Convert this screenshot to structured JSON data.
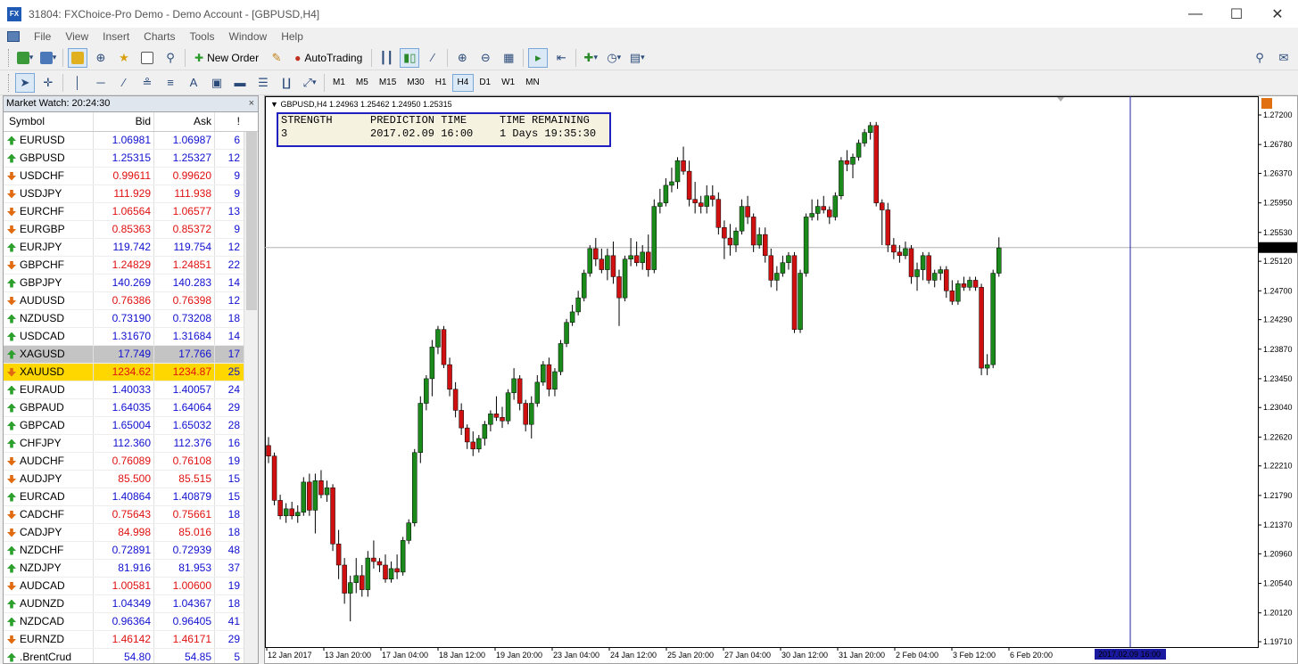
{
  "window": {
    "title": "31804: FXChoice-Pro Demo - Demo Account - [GBPUSD,H4]",
    "logo": "FX"
  },
  "menu": [
    "File",
    "View",
    "Insert",
    "Charts",
    "Tools",
    "Window",
    "Help"
  ],
  "toolbar": {
    "new_order": "New Order",
    "autotrading": "AutoTrading"
  },
  "timeframes": [
    "M1",
    "M5",
    "M15",
    "M30",
    "H1",
    "H4",
    "D1",
    "W1",
    "MN"
  ],
  "active_timeframe": "H4",
  "market_watch": {
    "title": "Market Watch: 20:24:30",
    "columns": {
      "symbol": "Symbol",
      "bid": "Bid",
      "ask": "Ask",
      "spread": "!"
    },
    "rows": [
      {
        "symbol": "EURUSD",
        "bid": "1.06981",
        "ask": "1.06987",
        "spread": "6",
        "dir": "up",
        "color": "blue"
      },
      {
        "symbol": "GBPUSD",
        "bid": "1.25315",
        "ask": "1.25327",
        "spread": "12",
        "dir": "up",
        "color": "blue"
      },
      {
        "symbol": "USDCHF",
        "bid": "0.99611",
        "ask": "0.99620",
        "spread": "9",
        "dir": "down",
        "color": "red"
      },
      {
        "symbol": "USDJPY",
        "bid": "111.929",
        "ask": "111.938",
        "spread": "9",
        "dir": "down",
        "color": "red"
      },
      {
        "symbol": "EURCHF",
        "bid": "1.06564",
        "ask": "1.06577",
        "spread": "13",
        "dir": "down",
        "color": "red"
      },
      {
        "symbol": "EURGBP",
        "bid": "0.85363",
        "ask": "0.85372",
        "spread": "9",
        "dir": "down",
        "color": "red"
      },
      {
        "symbol": "EURJPY",
        "bid": "119.742",
        "ask": "119.754",
        "spread": "12",
        "dir": "up",
        "color": "blue"
      },
      {
        "symbol": "GBPCHF",
        "bid": "1.24829",
        "ask": "1.24851",
        "spread": "22",
        "dir": "down",
        "color": "red"
      },
      {
        "symbol": "GBPJPY",
        "bid": "140.269",
        "ask": "140.283",
        "spread": "14",
        "dir": "up",
        "color": "blue"
      },
      {
        "symbol": "AUDUSD",
        "bid": "0.76386",
        "ask": "0.76398",
        "spread": "12",
        "dir": "down",
        "color": "red"
      },
      {
        "symbol": "NZDUSD",
        "bid": "0.73190",
        "ask": "0.73208",
        "spread": "18",
        "dir": "up",
        "color": "blue"
      },
      {
        "symbol": "USDCAD",
        "bid": "1.31670",
        "ask": "1.31684",
        "spread": "14",
        "dir": "up",
        "color": "blue"
      },
      {
        "symbol": "XAGUSD",
        "bid": "17.749",
        "ask": "17.766",
        "spread": "17",
        "dir": "up",
        "color": "blue",
        "state": "selected"
      },
      {
        "symbol": "XAUUSD",
        "bid": "1234.62",
        "ask": "1234.87",
        "spread": "25",
        "dir": "down",
        "color": "red",
        "state": "highlight"
      },
      {
        "symbol": "EURAUD",
        "bid": "1.40033",
        "ask": "1.40057",
        "spread": "24",
        "dir": "up",
        "color": "blue"
      },
      {
        "symbol": "GBPAUD",
        "bid": "1.64035",
        "ask": "1.64064",
        "spread": "29",
        "dir": "up",
        "color": "blue"
      },
      {
        "symbol": "GBPCAD",
        "bid": "1.65004",
        "ask": "1.65032",
        "spread": "28",
        "dir": "up",
        "color": "blue"
      },
      {
        "symbol": "CHFJPY",
        "bid": "112.360",
        "ask": "112.376",
        "spread": "16",
        "dir": "up",
        "color": "blue"
      },
      {
        "symbol": "AUDCHF",
        "bid": "0.76089",
        "ask": "0.76108",
        "spread": "19",
        "dir": "down",
        "color": "red"
      },
      {
        "symbol": "AUDJPY",
        "bid": "85.500",
        "ask": "85.515",
        "spread": "15",
        "dir": "down",
        "color": "red"
      },
      {
        "symbol": "EURCAD",
        "bid": "1.40864",
        "ask": "1.40879",
        "spread": "15",
        "dir": "up",
        "color": "blue"
      },
      {
        "symbol": "CADCHF",
        "bid": "0.75643",
        "ask": "0.75661",
        "spread": "18",
        "dir": "down",
        "color": "red"
      },
      {
        "symbol": "CADJPY",
        "bid": "84.998",
        "ask": "85.016",
        "spread": "18",
        "dir": "down",
        "color": "red"
      },
      {
        "symbol": "NZDCHF",
        "bid": "0.72891",
        "ask": "0.72939",
        "spread": "48",
        "dir": "up",
        "color": "blue"
      },
      {
        "symbol": "NZDJPY",
        "bid": "81.916",
        "ask": "81.953",
        "spread": "37",
        "dir": "up",
        "color": "blue"
      },
      {
        "symbol": "AUDCAD",
        "bid": "1.00581",
        "ask": "1.00600",
        "spread": "19",
        "dir": "down",
        "color": "red"
      },
      {
        "symbol": "AUDNZD",
        "bid": "1.04349",
        "ask": "1.04367",
        "spread": "18",
        "dir": "up",
        "color": "blue"
      },
      {
        "symbol": "NZDCAD",
        "bid": "0.96364",
        "ask": "0.96405",
        "spread": "41",
        "dir": "up",
        "color": "blue"
      },
      {
        "symbol": "EURNZD",
        "bid": "1.46142",
        "ask": "1.46171",
        "spread": "29",
        "dir": "down",
        "color": "red"
      },
      {
        "symbol": ".BrentCrud",
        "bid": "54.80",
        "ask": "54.85",
        "spread": "5",
        "dir": "up",
        "color": "blue"
      }
    ]
  },
  "chart": {
    "info": "GBPUSD,H4  1.24963 1.25462 1.24950 1.25315",
    "prediction": {
      "strength_label": "STRENGTH",
      "strength_value": "3",
      "time_label": "PREDICTION TIME",
      "time_value": "2017.02.09 16:00",
      "remaining_label": "TIME REMAINING",
      "remaining_value": "1 Days 19:35:30"
    },
    "marker_time": "2017.02.09 16:00"
  },
  "chart_data": {
    "type": "candlestick",
    "price_ticks": [
      "1.27200",
      "1.26780",
      "1.26370",
      "1.25950",
      "1.25530",
      "1.25120",
      "1.24700",
      "1.24290",
      "1.23870",
      "1.23450",
      "1.23040",
      "1.22620",
      "1.22210",
      "1.21790",
      "1.21370",
      "1.20960",
      "1.20540",
      "1.20120",
      "1.19710"
    ],
    "ylim": [
      1.1971,
      1.272
    ],
    "current_price": "1.25315",
    "time_labels": [
      "12 Jan 2017",
      "13 Jan 20:00",
      "17 Jan 04:00",
      "18 Jan 12:00",
      "19 Jan 20:00",
      "23 Jan 04:00",
      "24 Jan 12:00",
      "25 Jan 20:00",
      "27 Jan 04:00",
      "30 Jan 12:00",
      "31 Jan 20:00",
      "2 Feb 04:00",
      "3 Feb 12:00",
      "6 Feb 20:00"
    ],
    "colors": {
      "bull": "#1a8a1a",
      "bear": "#d01010",
      "wick": "#000000",
      "panel_border": "#2020c0",
      "marker": "#2020a0"
    },
    "candles": [
      [
        1.225,
        1.2262,
        1.2225,
        1.2235
      ],
      [
        1.2235,
        1.224,
        1.2165,
        1.2172
      ],
      [
        1.2172,
        1.218,
        1.2145,
        1.215
      ],
      [
        1.215,
        1.2168,
        1.214,
        1.216
      ],
      [
        1.216,
        1.217,
        1.2145,
        1.215
      ],
      [
        1.215,
        1.2165,
        1.214,
        1.2155
      ],
      [
        1.2155,
        1.2205,
        1.215,
        1.2198
      ],
      [
        1.2198,
        1.221,
        1.215,
        1.2158
      ],
      [
        1.2158,
        1.221,
        1.2125,
        1.22
      ],
      [
        1.22,
        1.2215,
        1.2175,
        1.218
      ],
      [
        1.218,
        1.22,
        1.217,
        1.219
      ],
      [
        1.219,
        1.2195,
        1.21,
        1.211
      ],
      [
        1.211,
        1.213,
        1.206,
        1.208
      ],
      [
        1.208,
        1.209,
        1.2025,
        1.204
      ],
      [
        1.204,
        1.2065,
        1.2,
        1.2055
      ],
      [
        1.2055,
        1.209,
        1.204,
        1.2065
      ],
      [
        1.2065,
        1.208,
        1.2035,
        1.2045
      ],
      [
        1.2045,
        1.21,
        1.2035,
        1.209
      ],
      [
        1.209,
        1.2115,
        1.2075,
        1.2085
      ],
      [
        1.2085,
        1.209,
        1.207,
        1.208
      ],
      [
        1.208,
        1.2095,
        1.2055,
        1.206
      ],
      [
        1.206,
        1.2085,
        1.2055,
        1.2075
      ],
      [
        1.2075,
        1.2095,
        1.206,
        1.207
      ],
      [
        1.207,
        1.212,
        1.2065,
        1.2115
      ],
      [
        1.2115,
        1.2145,
        1.211,
        1.214
      ],
      [
        1.214,
        1.2245,
        1.2135,
        1.224
      ],
      [
        1.224,
        1.232,
        1.2225,
        1.231
      ],
      [
        1.231,
        1.235,
        1.23,
        1.2345
      ],
      [
        1.2345,
        1.24,
        1.232,
        1.239
      ],
      [
        1.239,
        1.242,
        1.238,
        1.2415
      ],
      [
        1.2415,
        1.242,
        1.236,
        1.2365
      ],
      [
        1.2365,
        1.2375,
        1.232,
        1.233
      ],
      [
        1.233,
        1.234,
        1.229,
        1.23
      ],
      [
        1.23,
        1.231,
        1.2265,
        1.2275
      ],
      [
        1.2275,
        1.228,
        1.2245,
        1.2255
      ],
      [
        1.2255,
        1.227,
        1.2235,
        1.2245
      ],
      [
        1.2245,
        1.2265,
        1.224,
        1.226
      ],
      [
        1.226,
        1.2285,
        1.225,
        1.228
      ],
      [
        1.228,
        1.23,
        1.227,
        1.2295
      ],
      [
        1.2295,
        1.232,
        1.2285,
        1.229
      ],
      [
        1.229,
        1.2305,
        1.2275,
        1.2285
      ],
      [
        1.2285,
        1.233,
        1.228,
        1.2325
      ],
      [
        1.2325,
        1.236,
        1.2315,
        1.2345
      ],
      [
        1.2345,
        1.235,
        1.23,
        1.231
      ],
      [
        1.231,
        1.2315,
        1.227,
        1.228
      ],
      [
        1.228,
        1.232,
        1.226,
        1.231
      ],
      [
        1.231,
        1.235,
        1.2305,
        1.234
      ],
      [
        1.234,
        1.237,
        1.2335,
        1.2365
      ],
      [
        1.2365,
        1.2375,
        1.232,
        1.233
      ],
      [
        1.233,
        1.236,
        1.232,
        1.2355
      ],
      [
        1.2355,
        1.24,
        1.235,
        1.2395
      ],
      [
        1.2395,
        1.243,
        1.239,
        1.2425
      ],
      [
        1.2425,
        1.245,
        1.242,
        1.244
      ],
      [
        1.244,
        1.247,
        1.2435,
        1.246
      ],
      [
        1.246,
        1.25,
        1.2455,
        1.2495
      ],
      [
        1.2495,
        1.2535,
        1.249,
        1.253
      ],
      [
        1.253,
        1.2545,
        1.2505,
        1.2515
      ],
      [
        1.2515,
        1.253,
        1.2495,
        1.25
      ],
      [
        1.25,
        1.253,
        1.2485,
        1.252
      ],
      [
        1.252,
        1.254,
        1.248,
        1.249
      ],
      [
        1.249,
        1.25,
        1.242,
        1.246
      ],
      [
        1.246,
        1.252,
        1.2455,
        1.2515
      ],
      [
        1.2515,
        1.2545,
        1.2505,
        1.252
      ],
      [
        1.252,
        1.254,
        1.2505,
        1.251
      ],
      [
        1.251,
        1.2535,
        1.25,
        1.2525
      ],
      [
        1.2525,
        1.255,
        1.249,
        1.25
      ],
      [
        1.25,
        1.26,
        1.2495,
        1.259
      ],
      [
        1.259,
        1.2615,
        1.258,
        1.2595
      ],
      [
        1.2595,
        1.263,
        1.259,
        1.262
      ],
      [
        1.262,
        1.2645,
        1.261,
        1.2625
      ],
      [
        1.2625,
        1.266,
        1.2615,
        1.2655
      ],
      [
        1.2655,
        1.2675,
        1.2635,
        1.264
      ],
      [
        1.264,
        1.2655,
        1.259,
        1.26
      ],
      [
        1.26,
        1.2625,
        1.258,
        1.2595
      ],
      [
        1.2595,
        1.2605,
        1.258,
        1.259
      ],
      [
        1.259,
        1.262,
        1.258,
        1.2605
      ],
      [
        1.2605,
        1.262,
        1.259,
        1.26
      ],
      [
        1.26,
        1.261,
        1.255,
        1.256
      ],
      [
        1.256,
        1.257,
        1.2515,
        1.2545
      ],
      [
        1.2545,
        1.2565,
        1.252,
        1.2535
      ],
      [
        1.2535,
        1.256,
        1.2525,
        1.2555
      ],
      [
        1.2555,
        1.26,
        1.255,
        1.259
      ],
      [
        1.259,
        1.2605,
        1.2565,
        1.2575
      ],
      [
        1.2575,
        1.258,
        1.2525,
        1.2535
      ],
      [
        1.2535,
        1.256,
        1.253,
        1.255
      ],
      [
        1.255,
        1.256,
        1.251,
        1.252
      ],
      [
        1.252,
        1.253,
        1.2475,
        1.2485
      ],
      [
        1.2485,
        1.2505,
        1.247,
        1.2495
      ],
      [
        1.2495,
        1.252,
        1.249,
        1.251
      ],
      [
        1.251,
        1.2525,
        1.25,
        1.252
      ],
      [
        1.252,
        1.2525,
        1.241,
        1.2415
      ],
      [
        1.2415,
        1.25,
        1.241,
        1.2495
      ],
      [
        1.2495,
        1.258,
        1.249,
        1.2575
      ],
      [
        1.2575,
        1.26,
        1.257,
        1.258
      ],
      [
        1.258,
        1.26,
        1.257,
        1.259
      ],
      [
        1.259,
        1.2605,
        1.258,
        1.2585
      ],
      [
        1.2585,
        1.259,
        1.2565,
        1.2575
      ],
      [
        1.2575,
        1.261,
        1.257,
        1.2605
      ],
      [
        1.2605,
        1.266,
        1.26,
        1.2655
      ],
      [
        1.2655,
        1.267,
        1.264,
        1.265
      ],
      [
        1.265,
        1.2665,
        1.263,
        1.266
      ],
      [
        1.266,
        1.2685,
        1.2655,
        1.268
      ],
      [
        1.268,
        1.27,
        1.2675,
        1.2695
      ],
      [
        1.2695,
        1.271,
        1.2685,
        1.2705
      ],
      [
        1.2705,
        1.271,
        1.259,
        1.2595
      ],
      [
        1.2595,
        1.26,
        1.2535,
        1.2585
      ],
      [
        1.2585,
        1.2595,
        1.2525,
        1.2535
      ],
      [
        1.2535,
        1.2545,
        1.2515,
        1.2525
      ],
      [
        1.2525,
        1.2535,
        1.251,
        1.252
      ],
      [
        1.252,
        1.254,
        1.2515,
        1.253
      ],
      [
        1.253,
        1.2535,
        1.248,
        1.249
      ],
      [
        1.249,
        1.251,
        1.247,
        1.25
      ],
      [
        1.25,
        1.2525,
        1.2485,
        1.252
      ],
      [
        1.252,
        1.2525,
        1.248,
        1.2485
      ],
      [
        1.2485,
        1.25,
        1.2475,
        1.2495
      ],
      [
        1.2495,
        1.2505,
        1.2485,
        1.25
      ],
      [
        1.25,
        1.2505,
        1.246,
        1.247
      ],
      [
        1.247,
        1.2485,
        1.245,
        1.2455
      ],
      [
        1.2455,
        1.2485,
        1.245,
        1.248
      ],
      [
        1.248,
        1.249,
        1.247,
        1.2475
      ],
      [
        1.2475,
        1.249,
        1.247,
        1.2485
      ],
      [
        1.2485,
        1.249,
        1.247,
        1.2475
      ],
      [
        1.2475,
        1.248,
        1.235,
        1.236
      ],
      [
        1.236,
        1.238,
        1.235,
        1.2365
      ],
      [
        1.2365,
        1.25,
        1.236,
        1.2495
      ],
      [
        1.2495,
        1.2546,
        1.249,
        1.2531
      ]
    ]
  }
}
